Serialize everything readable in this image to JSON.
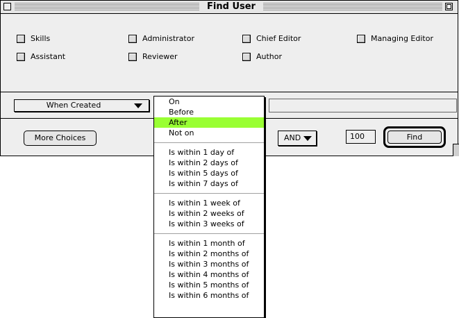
{
  "window": {
    "title": "Find User"
  },
  "roles": [
    "Skills",
    "Administrator",
    "Chief Editor",
    "Managing Editor",
    "Assistant",
    "Reviewer",
    "Author"
  ],
  "criteria": {
    "field_label": "When Created",
    "text_value": ""
  },
  "buttons": {
    "more_choices": "More Choices",
    "find": "Find"
  },
  "logic": {
    "operator": "AND"
  },
  "limit": {
    "value": "100"
  },
  "menu": {
    "groups": [
      [
        "On",
        "Before",
        "After",
        "Not on"
      ],
      [
        "Is within 1 day of",
        "Is within 2 days of",
        "Is within 5 days of",
        "Is within 7 days of"
      ],
      [
        "Is within 1 week of",
        "Is within 2 weeks of",
        "Is within 3 weeks of"
      ],
      [
        "Is within 1 month of",
        "Is within 2 months of",
        "Is within 3 months of",
        "Is within 4 months of",
        "Is within 5 months of",
        "Is within 6 months of"
      ]
    ],
    "selected": "After",
    "highlight_color": "#99ff33"
  }
}
